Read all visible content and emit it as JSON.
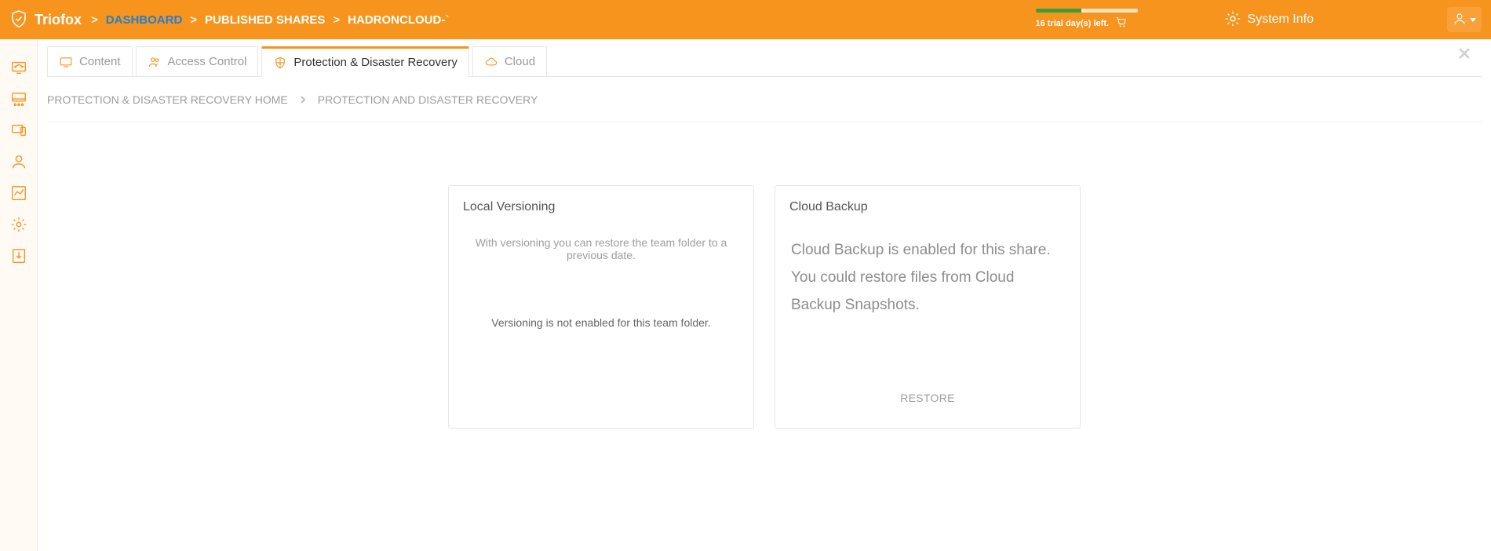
{
  "topbar": {
    "brand": "Triofox",
    "crumbs": {
      "dashboard": "DASHBOARD",
      "published": "PUBLISHED SHARES",
      "item": "HADRONCLOUD-`"
    },
    "trial_text": "16 trial day(s) left.",
    "system_info": "System Info"
  },
  "tabs": {
    "content": "Content",
    "access": "Access Control",
    "protection": "Protection & Disaster Recovery",
    "cloud": "Cloud"
  },
  "subcrumbs": {
    "home": "PROTECTION & DISASTER RECOVERY HOME",
    "current": "PROTECTION AND DISASTER RECOVERY"
  },
  "cards": {
    "versioning": {
      "title": "Local Versioning",
      "desc": "With versioning you can restore the team folder to a previous date.",
      "status": "Versioning is not enabled for this team folder."
    },
    "cloud": {
      "title": "Cloud Backup",
      "body": "Cloud Backup is enabled for this share. You could restore files from Cloud Backup Snapshots.",
      "restore": "RESTORE"
    }
  },
  "icons": {
    "shield": "brand-shield-icon",
    "cart": "shopping-cart-icon",
    "gear": "settings-gear-icon",
    "user": "user-avatar-icon"
  }
}
